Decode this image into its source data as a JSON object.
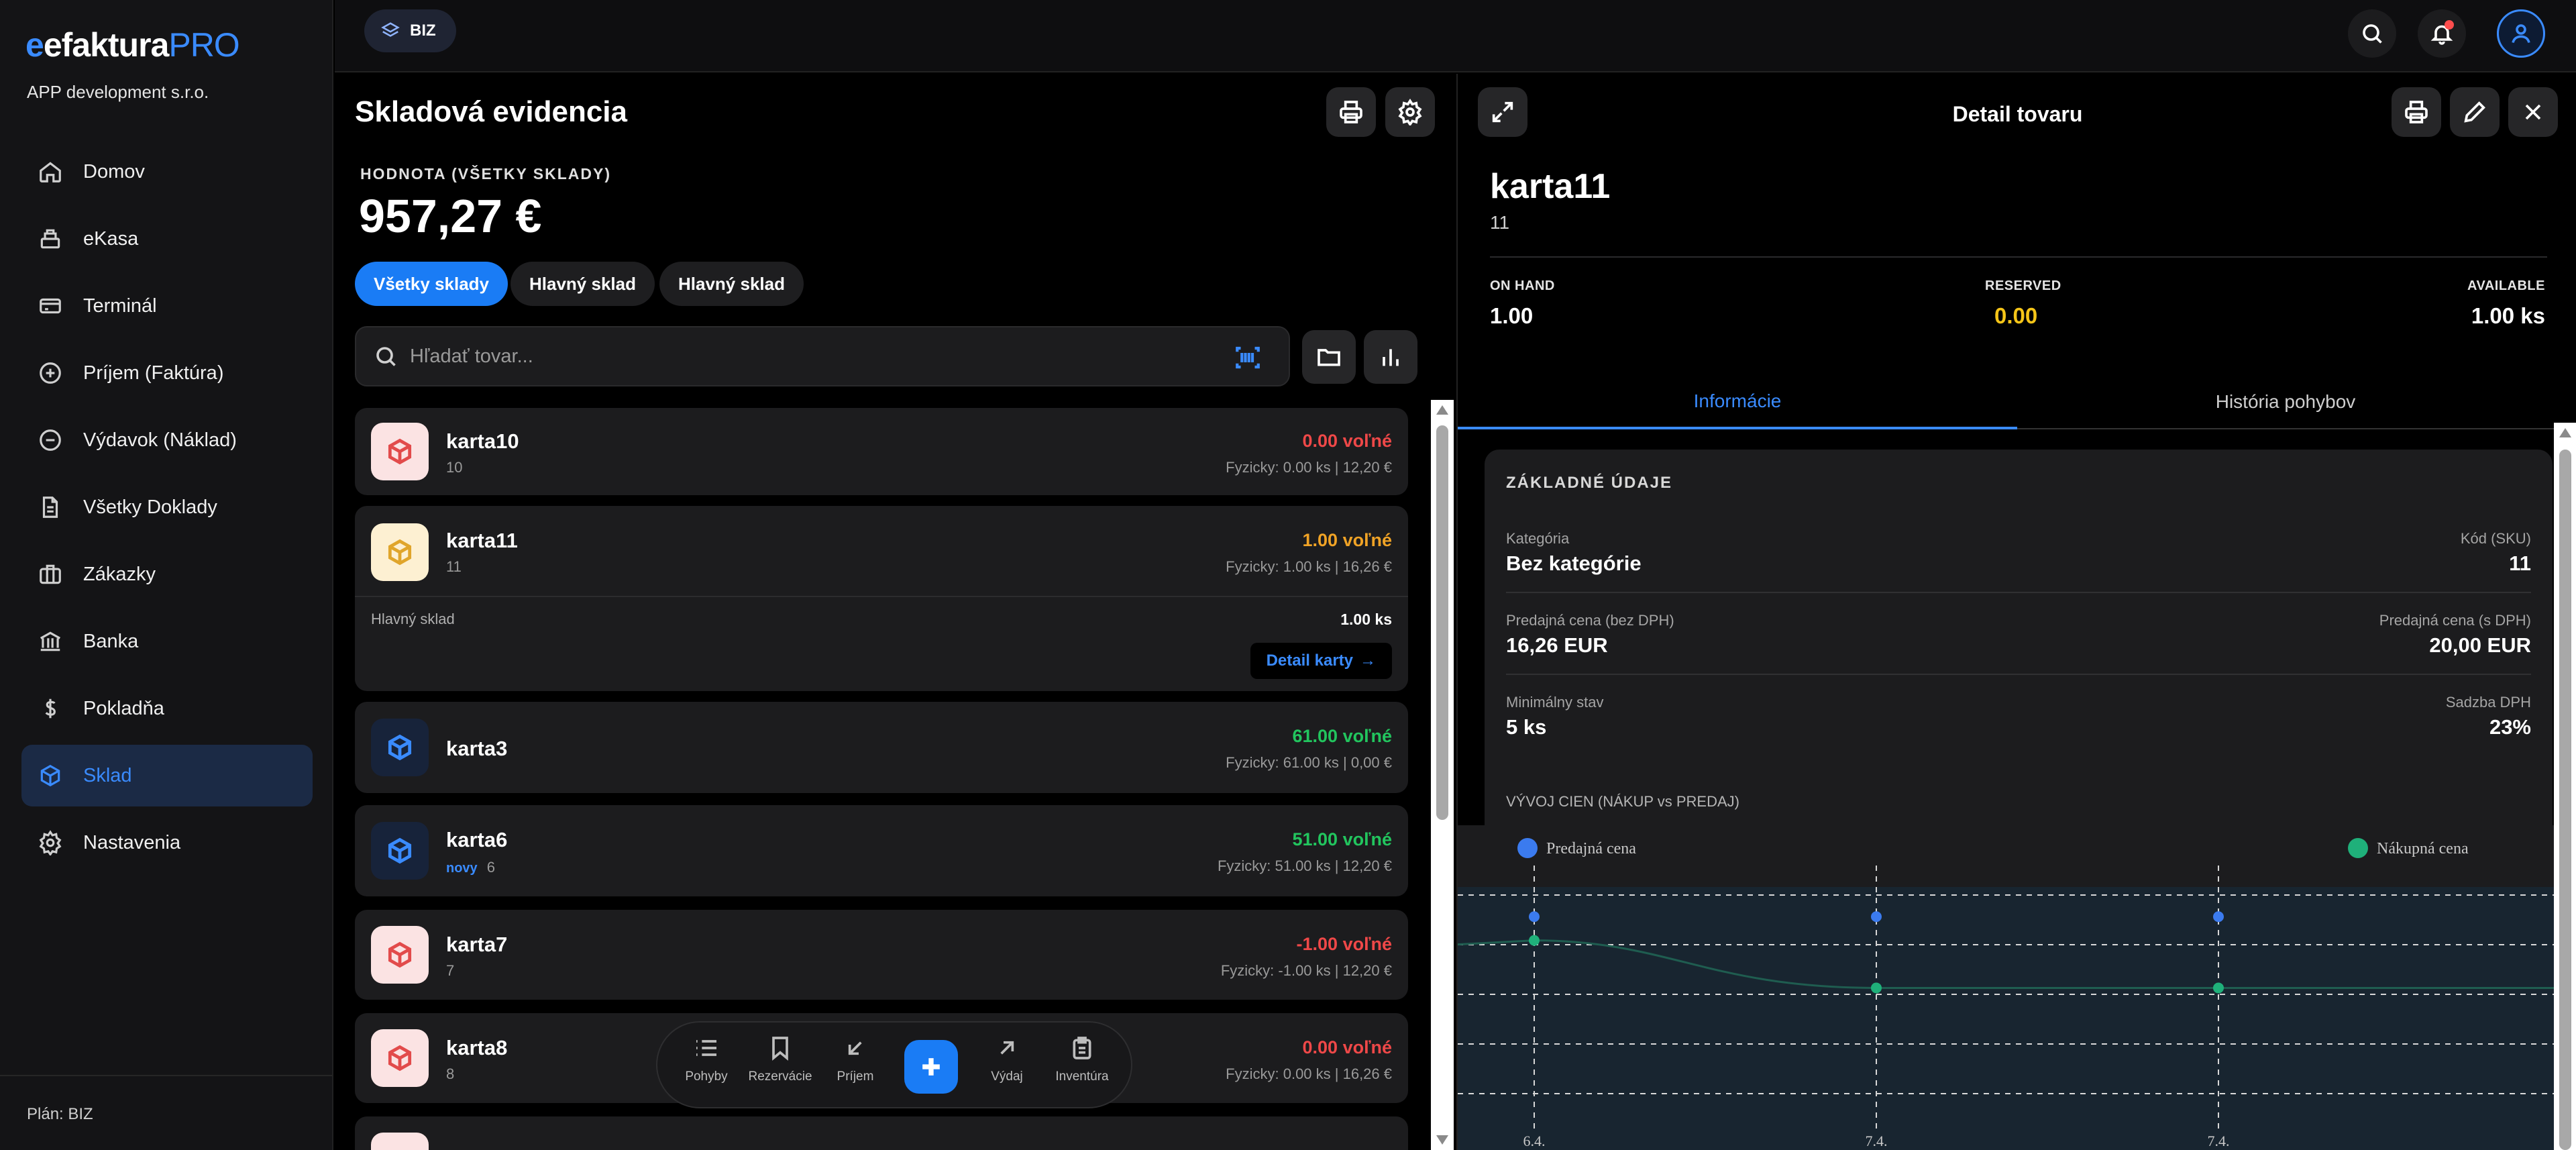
{
  "app": {
    "logo_main": "efaktura",
    "logo_pro": "PRO",
    "company": "APP development s.r.o."
  },
  "sidebar": {
    "items": [
      {
        "label": "Domov",
        "icon": "home-icon"
      },
      {
        "label": "eKasa",
        "icon": "cash-register-icon"
      },
      {
        "label": "Terminál",
        "icon": "card-icon"
      },
      {
        "label": "Príjem (Faktúra)",
        "icon": "plus-circle-icon"
      },
      {
        "label": "Výdavok (Náklad)",
        "icon": "minus-circle-icon"
      },
      {
        "label": "Všetky Doklady",
        "icon": "document-icon"
      },
      {
        "label": "Zákazky",
        "icon": "briefcase-icon"
      },
      {
        "label": "Banka",
        "icon": "bank-icon"
      },
      {
        "label": "Pokladňa",
        "icon": "dollar-icon"
      },
      {
        "label": "Sklad",
        "icon": "box-icon",
        "active": true
      },
      {
        "label": "Nastavenia",
        "icon": "gear-icon"
      }
    ],
    "plan": "Plán: BIZ"
  },
  "topbar": {
    "badge": "BIZ"
  },
  "inventory": {
    "title": "Skladová evidencia",
    "value_label": "HODNOTA (VŠETKY SKLADY)",
    "value_amount": "957,27 €",
    "filters": [
      "Všetky sklady",
      "Hlavný sklad",
      "Hlavný sklad"
    ],
    "search_placeholder": "Hľadať tovar...",
    "items": [
      {
        "name": "karta10",
        "code": "10",
        "free": "0.00 voľné",
        "phys": "Fyzicky: 0.00 ks | 12,20 €"
      },
      {
        "name": "karta11",
        "code": "11",
        "free": "1.00 voľné",
        "phys": "Fyzicky: 1.00 ks | 16,26 €",
        "warehouse": "Hlavný sklad",
        "warehouse_qty": "1.00 ks",
        "detail_button": "Detail karty"
      },
      {
        "name": "karta3",
        "code": "",
        "free": "61.00 voľné",
        "phys": "Fyzicky: 61.00 ks | 0,00 €"
      },
      {
        "name": "karta6",
        "tag": "novy",
        "code": "6",
        "free": "51.00 voľné",
        "phys": "Fyzicky: 51.00 ks | 12,20 €"
      },
      {
        "name": "karta7",
        "code": "7",
        "free": "-1.00 voľné",
        "phys": "Fyzicky: -1.00 ks | 12,20 €"
      },
      {
        "name": "karta8",
        "code": "8",
        "free": "0.00 voľné",
        "phys": "Fyzicky: 0.00 ks | 16,26 €"
      }
    ],
    "colors": {
      "negative": "#ef4848",
      "low": "#f0a326",
      "positive": "#22c55e"
    }
  },
  "dock": {
    "items": [
      {
        "label": "Pohyby",
        "icon": "list-icon"
      },
      {
        "label": "Rezervácie",
        "icon": "bookmark-icon"
      },
      {
        "label": "Príjem",
        "icon": "arrow-down-left-icon"
      },
      {
        "label": "Výdaj",
        "icon": "arrow-up-right-icon"
      },
      {
        "label": "Inventúra",
        "icon": "clipboard-icon"
      }
    ]
  },
  "detail": {
    "title": "Detail tovaru",
    "name": "karta11",
    "code": "11",
    "stats": {
      "on_hand_label": "ON HAND",
      "on_hand": "1.00",
      "reserved_label": "RESERVED",
      "reserved": "0.00",
      "available_label": "AVAILABLE",
      "available": "1.00 ks"
    },
    "tabs": [
      "Informácie",
      "História pohybov"
    ],
    "section_title": "ZÁKLADNÉ ÚDAJE",
    "fields": {
      "category_label": "Kategória",
      "category": "Bez kategórie",
      "sku_label": "Kód (SKU)",
      "sku": "11",
      "price_net_label": "Predajná cena (bez DPH)",
      "price_net": "16,26 EUR",
      "price_gross_label": "Predajná cena (s DPH)",
      "price_gross": "20,00 EUR",
      "min_label": "Minimálny stav",
      "min": "5 ks",
      "vat_label": "Sadzba DPH",
      "vat": "23%"
    },
    "chart_title": "VÝVOJ CIEN (NÁKUP vs PREDAJ)"
  },
  "chart_data": {
    "type": "line",
    "categories": [
      "6.4.",
      "7.4.",
      "7.4."
    ],
    "series": [
      {
        "name": "Predajná cena",
        "color": "#3b7bef",
        "values": [
          20.0,
          20.0,
          20.0
        ]
      },
      {
        "name": "Nákupná cena",
        "color": "#1fb07a",
        "values": [
          19.6,
          18.8,
          18.8
        ]
      }
    ],
    "ylim": [
      16.5,
      20.5
    ],
    "grid": true,
    "legend": "top"
  }
}
